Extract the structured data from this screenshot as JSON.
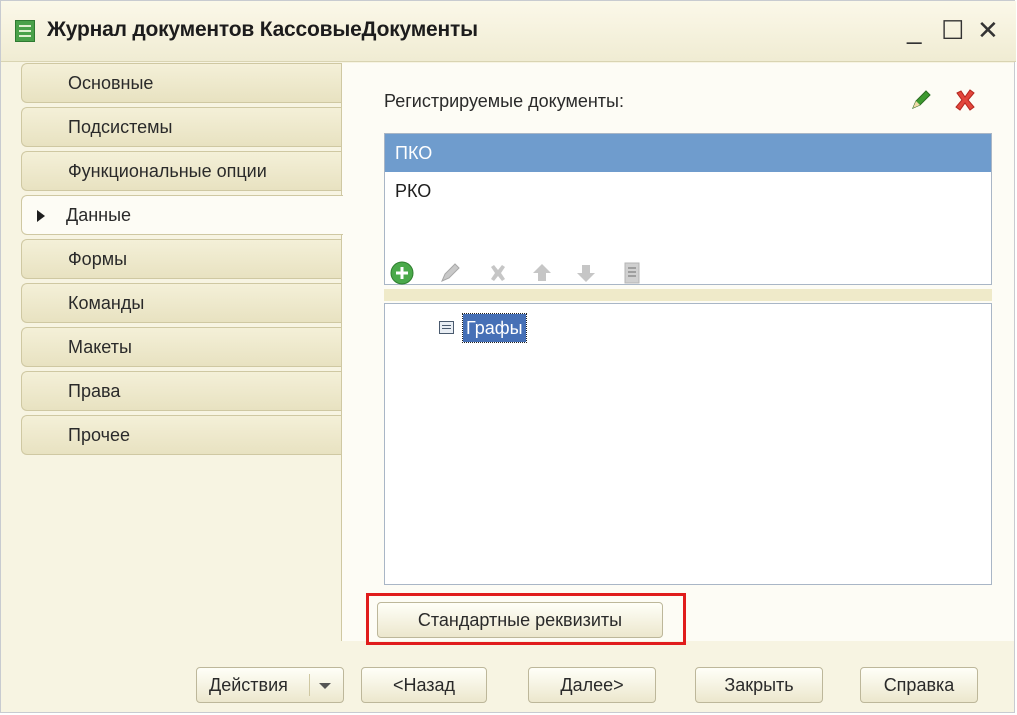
{
  "window": {
    "title": "Журнал документов КассовыеДокументы",
    "controls": {
      "minimize": "_",
      "maximize": "☐",
      "close": "✕"
    }
  },
  "tabs": [
    {
      "label": "Основные",
      "active": false
    },
    {
      "label": "Подсистемы",
      "active": false
    },
    {
      "label": "Функциональные опции",
      "active": false
    },
    {
      "label": "Данные",
      "active": true
    },
    {
      "label": "Формы",
      "active": false
    },
    {
      "label": "Команды",
      "active": false
    },
    {
      "label": "Макеты",
      "active": false
    },
    {
      "label": "Права",
      "active": false
    },
    {
      "label": "Прочее",
      "active": false
    }
  ],
  "registered_documents": {
    "label": "Регистрируемые документы:",
    "items": [
      {
        "name": "ПКО",
        "selected": true
      },
      {
        "name": "РКО",
        "selected": false
      }
    ],
    "icons": {
      "edit": "pencil-icon",
      "delete": "x-icon"
    }
  },
  "columns_toolbar": {
    "icons": [
      "add-icon",
      "edit-icon",
      "delete-icon",
      "move-up-icon",
      "move-down-icon",
      "list-icon"
    ]
  },
  "columns_tree": {
    "items": [
      {
        "label": "Графы",
        "selected": true
      }
    ]
  },
  "standard_attributes_button": "Стандартные реквизиты",
  "footer": {
    "actions": "Действия",
    "back": "<Назад",
    "next": "Далее>",
    "close": "Закрыть",
    "help": "Справка"
  },
  "colors": {
    "selection": "#6f9ccd",
    "highlight_frame": "#e01c1c",
    "panel": "#fdfcf5",
    "tab": "#e8e2c1"
  }
}
